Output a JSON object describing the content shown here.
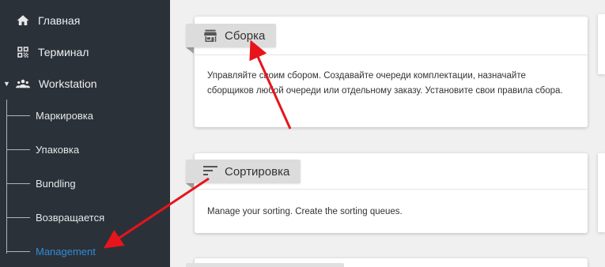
{
  "sidebar": {
    "items": [
      {
        "label": "Главная",
        "icon": "home-icon"
      },
      {
        "label": "Терминал",
        "icon": "qr-code-icon"
      },
      {
        "label": "Workstation",
        "icon": "group-icon",
        "expanded": true
      }
    ],
    "sub_items": [
      {
        "label": "Маркировка"
      },
      {
        "label": "Упаковка"
      },
      {
        "label": "Bundling"
      },
      {
        "label": "Возвращается"
      },
      {
        "label": "Management",
        "active": true
      }
    ]
  },
  "cards": [
    {
      "title": "Сборка",
      "icon": "store-icon",
      "description": "Управляйте своим сбором. Создавайте очереди комплектации, назначайте сборщиков любой очереди или отдельному заказу. Установите свои правила сбора."
    },
    {
      "title": "Сортировка",
      "icon": "sort-icon",
      "description": "Manage your sorting. Create the sorting queues."
    }
  ],
  "colors": {
    "sidebar_bg": "#2b3138",
    "active_link": "#2f8cd9",
    "annotation_arrow": "#e8141b",
    "tab_bg": "#dcdcdc",
    "page_bg": "#f0f0f0"
  }
}
